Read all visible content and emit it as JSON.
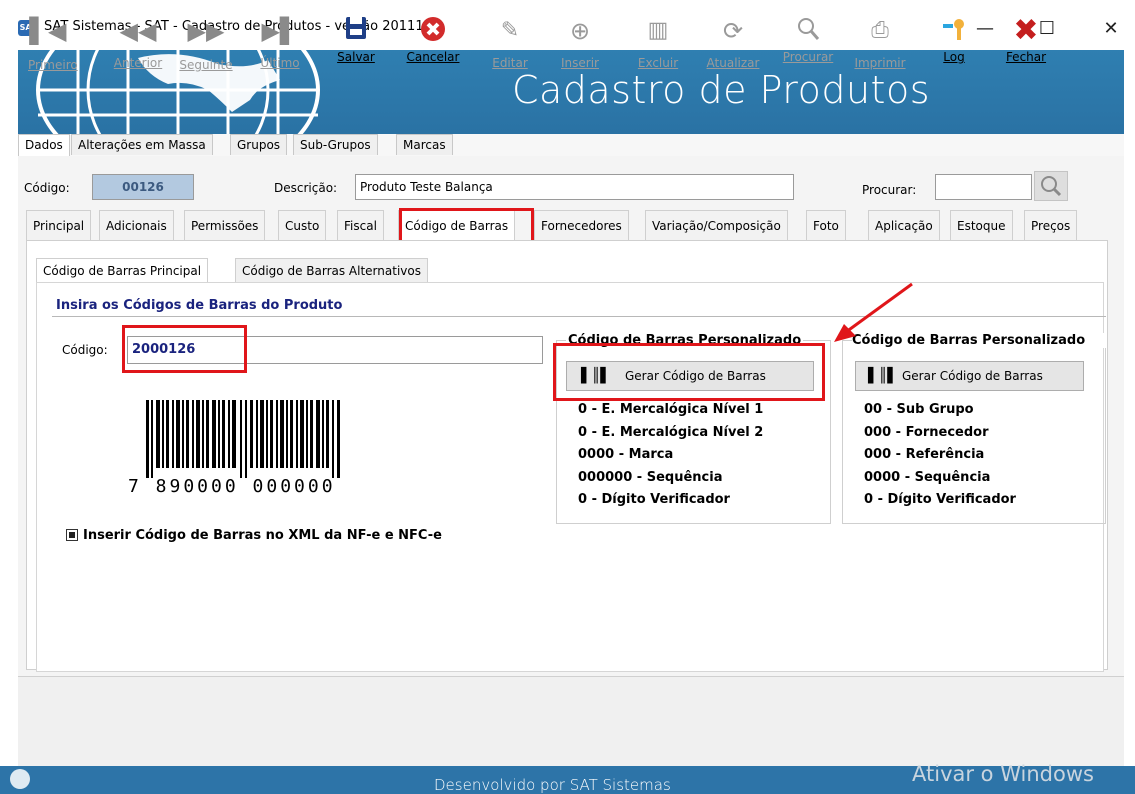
{
  "window": {
    "title": "SAT Sistemas - SAT - Cadastro de Produtos - versão 201111A",
    "icon": "sat-app-icon"
  },
  "banner": {
    "title": "Cadastro de Produtos"
  },
  "top_tabs": [
    "Dados",
    "Alterações em Massa",
    "Grupos",
    "Sub-Grupos",
    "Marcas"
  ],
  "header": {
    "codigo_label": "Código:",
    "codigo_value": "00126",
    "descricao_label": "Descrição:",
    "descricao_value": "Produto Teste Balança",
    "procurar_label": "Procurar:",
    "procurar_value": ""
  },
  "inner_tabs": [
    "Principal",
    "Adicionais",
    "Permissões",
    "Custo",
    "Fiscal",
    "Código de Barras",
    "Fornecedores",
    "Variação/Composição",
    "Foto",
    "Aplicação",
    "Estoque",
    "Preços"
  ],
  "sub_tabs": [
    "Código de Barras Principal",
    "Código de Barras Alternativos"
  ],
  "barcode": {
    "section_title": "Insira os Códigos de Barras do Produto",
    "codigo_label": "Código:",
    "codigo_value": "2000126",
    "barcode_text": "7 890000 000000",
    "xml_checkbox_label": "Inserir Código de Barras no XML da NF-e e NFC-e",
    "xml_checked": true
  },
  "custom1": {
    "title": "Código de Barras Personalizado",
    "button": "Gerar Código de Barras",
    "lines": [
      "0 - E. Mercalógica Nível 1",
      "0 - E. Mercalógica Nível 2",
      "0000 - Marca",
      "000000 - Sequência",
      "0 - Dígito Verificador"
    ]
  },
  "custom2": {
    "title": "Código de Barras Personalizado",
    "button": "Gerar Código de Barras",
    "lines": [
      "00 - Sub Grupo",
      "000 - Fornecedor",
      "000 - Referência",
      "0000 - Sequência",
      "0 - Dígito Verificador"
    ]
  },
  "toolbar": [
    {
      "label": "Primeiro",
      "icon": "first-icon",
      "enabled": false
    },
    {
      "label": "Anterior",
      "icon": "previous-icon",
      "enabled": false
    },
    {
      "label": "Seguinte",
      "icon": "next-icon",
      "enabled": false
    },
    {
      "label": "Último",
      "icon": "last-icon",
      "enabled": false
    },
    {
      "label": "Salvar",
      "icon": "save-icon",
      "enabled": true
    },
    {
      "label": "Cancelar",
      "icon": "cancel-icon",
      "enabled": true
    },
    {
      "label": "Editar",
      "icon": "edit-icon",
      "enabled": false
    },
    {
      "label": "Inserir",
      "icon": "insert-icon",
      "enabled": false
    },
    {
      "label": "Excluir",
      "icon": "delete-icon",
      "enabled": false
    },
    {
      "label": "Atualizar",
      "icon": "refresh-icon",
      "enabled": false
    },
    {
      "label": "Procurar",
      "icon": "search-icon",
      "enabled": false
    },
    {
      "label": "Imprimir",
      "icon": "print-icon",
      "enabled": false
    },
    {
      "label": "Log",
      "icon": "log-icon",
      "enabled": true
    },
    {
      "label": "Fechar",
      "icon": "close-icon",
      "enabled": true
    }
  ],
  "status": {
    "text": "Desenvolvido por SAT Sistemas",
    "watermark": "Ativar o Windows"
  },
  "colors": {
    "accent": "#2d74a8",
    "highlight": "#e0161a",
    "title_blue": "#1a237e"
  }
}
